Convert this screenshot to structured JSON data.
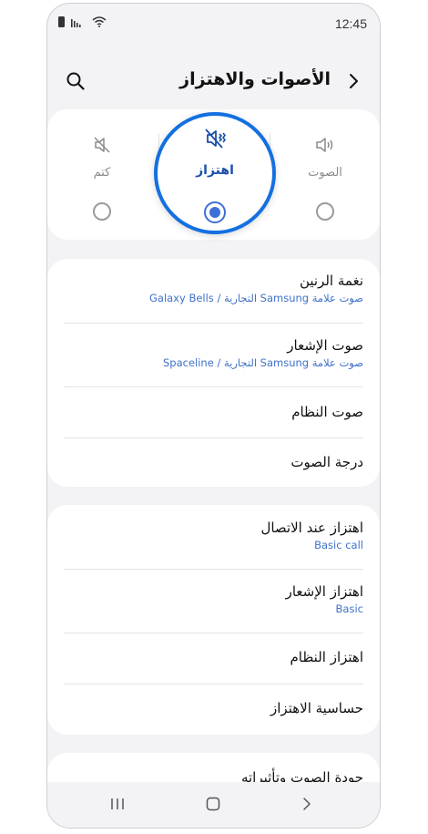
{
  "status": {
    "time": "12:45"
  },
  "header": {
    "title": "الأصوات والاهتزاز"
  },
  "modes": {
    "sound": {
      "label": "الصوت"
    },
    "vibrate": {
      "label": "اهتزاز"
    },
    "mute": {
      "label": "كتم"
    },
    "selected": "vibrate"
  },
  "group1": [
    {
      "title": "نغمة الرنين",
      "subtitle": "صوت علامة Samsung التجارية / Galaxy Bells"
    },
    {
      "title": "صوت الإشعار",
      "subtitle": "صوت علامة Samsung التجارية / Spaceline"
    },
    {
      "title": "صوت النظام"
    },
    {
      "title": "درجة الصوت"
    }
  ],
  "group2": [
    {
      "title": "اهتزاز عند الاتصال",
      "subtitle": "Basic call"
    },
    {
      "title": "اهتزاز الإشعار",
      "subtitle": "Basic"
    },
    {
      "title": "اهتزاز النظام"
    },
    {
      "title": "حساسية الاهتزاز"
    }
  ],
  "group3": [
    {
      "title": "جودة الصوت وتأثيراته"
    }
  ],
  "colors": {
    "accent": "#3d6fd6",
    "highlight_ring": "#1470e0",
    "subtitle": "#3f71c9",
    "background": "#f3f3f6"
  }
}
